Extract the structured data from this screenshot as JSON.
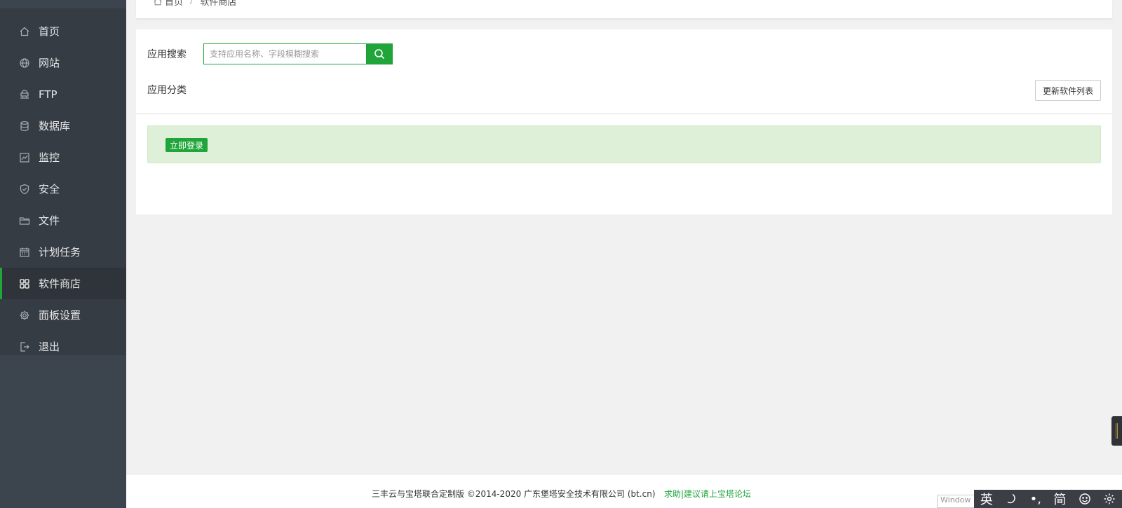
{
  "sidebar": {
    "items": [
      {
        "label": "首页",
        "icon": "home-icon"
      },
      {
        "label": "网站",
        "icon": "globe-icon"
      },
      {
        "label": "FTP",
        "icon": "ftp-icon"
      },
      {
        "label": "数据库",
        "icon": "database-icon"
      },
      {
        "label": "监控",
        "icon": "monitor-icon"
      },
      {
        "label": "安全",
        "icon": "shield-icon"
      },
      {
        "label": "文件",
        "icon": "folder-icon"
      },
      {
        "label": "计划任务",
        "icon": "calendar-icon"
      },
      {
        "label": "软件商店",
        "icon": "grid-icon",
        "active": true
      },
      {
        "label": "面板设置",
        "icon": "gear-icon"
      },
      {
        "label": "退出",
        "icon": "logout-icon"
      }
    ]
  },
  "breadcrumb": {
    "home": "首页",
    "separator": "/",
    "current": "软件商店"
  },
  "search": {
    "label": "应用搜索",
    "placeholder": "支持应用名称、字段模糊搜索",
    "value": ""
  },
  "category": {
    "label": "应用分类"
  },
  "toolbar": {
    "update_label": "更新软件列表"
  },
  "notice": {
    "login_label": "立即登录"
  },
  "footer": {
    "copyright": "三丰云与宝塔联合定制版 ©2014-2020 广东堡塔安全技术有限公司 (bt.cn)",
    "link": "求助|建议请上宝塔论坛"
  },
  "watermark": {
    "text": "Window"
  },
  "ime": {
    "lang": "英",
    "punct": "•,",
    "script": "简"
  },
  "colors": {
    "accent": "#20a53a",
    "sidebar_bg": "#3c444d",
    "notice_bg": "#dff0d8"
  }
}
